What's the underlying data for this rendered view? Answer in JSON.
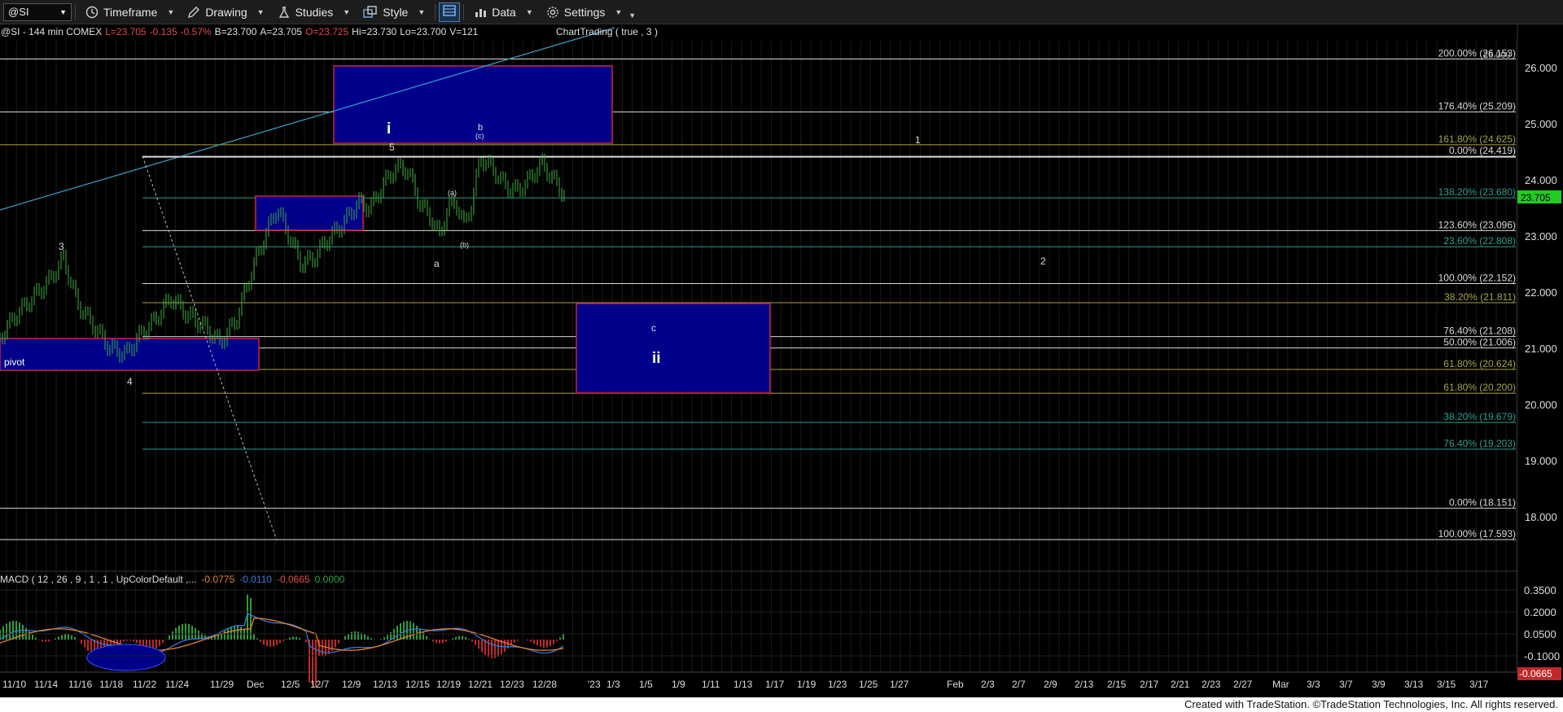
{
  "toolbar": {
    "symbol": "@SI",
    "timeframe": "Timeframe",
    "drawing": "Drawing",
    "studies": "Studies",
    "style": "Style",
    "data": "Data",
    "settings": "Settings"
  },
  "header": {
    "prefix": "@SI - 144 min  COMEX",
    "last": "L=23.705",
    "change": "-0.135",
    "change_pct": "-0.57%",
    "bid": "B=23.700",
    "ask": "A=23.705",
    "open": "O=23.725",
    "high": "Hi=23.730",
    "low": "Lo=23.700",
    "volume": "V=121",
    "chart_trading": "ChartTrading ( true , 3 )"
  },
  "price_axis": {
    "ticks": [
      "26.000",
      "25.000",
      "24.000",
      "23.000",
      "22.000",
      "21.000",
      "20.000",
      "19.000",
      "18.000"
    ],
    "current": "23.705"
  },
  "macd": {
    "label": "MACD ( 12 , 26 , 9 , 1 , 1 , UpColorDefault ,...",
    "v1": "-0.0775",
    "v2": "-0.0110",
    "v3": "-0.0665",
    "v4": "0.0000",
    "axis_ticks": [
      "0.3500",
      "0.2000",
      "0.0500",
      "-0.1000"
    ],
    "current": "-0.0665"
  },
  "fib_levels": [
    {
      "label": "200.00% (26.153)",
      "color": "#d8d8d8"
    },
    {
      "label": "176.40% (25.209)",
      "color": "#d8d8d8"
    },
    {
      "label": "161.80% (24.625)",
      "color": "#a8a04a"
    },
    {
      "label": "0.00% (24.419)",
      "color": "#d8d8d8"
    },
    {
      "label": "138.20% (23.680)",
      "color": "#2f9a8c"
    },
    {
      "label": "123.60% (23.096)",
      "color": "#d8d8d8"
    },
    {
      "label": "23.60% (22.808)",
      "color": "#2f9a8c"
    },
    {
      "label": "100.00% (22.152)",
      "color": "#d8d8d8"
    },
    {
      "label": "38.20% (21.811)",
      "color": "#a8a04a"
    },
    {
      "label": "76.40% (21.208)",
      "color": "#d8d8d8"
    },
    {
      "label": "50.00% (21.006)",
      "color": "#d8d8d8"
    },
    {
      "label": "61.80% (20.624)",
      "color": "#a8a04a"
    },
    {
      "label": "61.80% (20.200)",
      "color": "#a8a04a"
    },
    {
      "label": "38.20% (19.679)",
      "color": "#2f9a8c"
    },
    {
      "label": "76.40% (19.203)",
      "color": "#2f9a8c"
    },
    {
      "label": "0.00% (18.151)",
      "color": "#d8d8d8"
    },
    {
      "label": "100.00% (17.593)",
      "color": "#d8d8d8"
    }
  ],
  "wave_labels": [
    "3",
    "4",
    "pivot",
    "i",
    "5",
    "b",
    "(c)",
    "(a)",
    "(b)",
    "a",
    "1",
    "2",
    "c",
    "ii",
    "26.000"
  ],
  "date_axis": [
    "11/10",
    "11/14",
    "11/16",
    "11/18",
    "11/22",
    "11/24",
    "11/29",
    "Dec",
    "12/5",
    "12/7",
    "12/9",
    "12/13",
    "12/15",
    "12/19",
    "12/21",
    "12/23",
    "12/28",
    "'23",
    "1/3",
    "1/5",
    "1/9",
    "1/11",
    "1/13",
    "1/17",
    "1/19",
    "1/23",
    "1/25",
    "1/27",
    "Feb",
    "2/3",
    "2/7",
    "2/9",
    "2/13",
    "2/15",
    "2/17",
    "2/21",
    "2/23",
    "2/27",
    "Mar",
    "3/3",
    "3/7",
    "3/9",
    "3/13",
    "3/15",
    "3/17"
  ],
  "footer": "Created with TradeStation. ©TradeStation Technologies, Inc. All rights reserved.",
  "colors": {
    "background": "#000000",
    "price_bar": "#3fae3f",
    "box_fill": "#00008b",
    "box_border": "#cc2233",
    "trendline": "#3aa0c8",
    "macd_line": "#3a78d8",
    "signal_line": "#e08030",
    "hist_up": "#2e9e3a",
    "hist_down": "#c02828",
    "current_price_bg": "#22cc22"
  }
}
